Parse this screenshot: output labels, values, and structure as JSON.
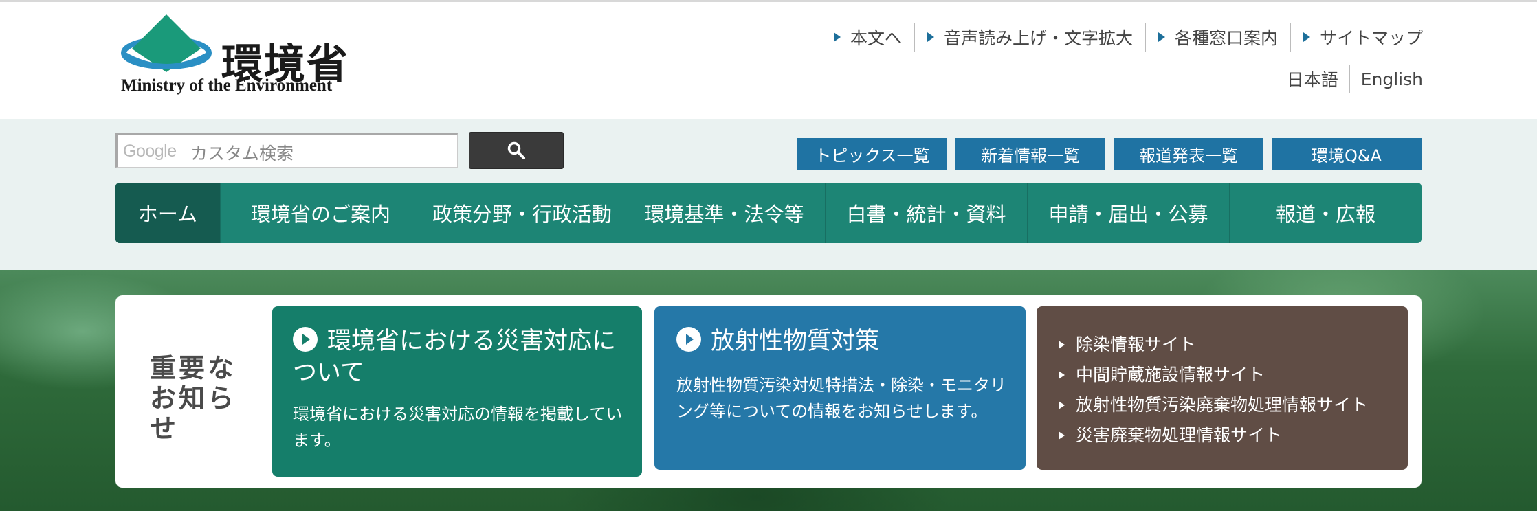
{
  "header": {
    "logo_jp": "環境省",
    "logo_en": "Ministry of the Environment",
    "util_links": [
      "本文へ",
      "音声読み上げ・文字拡大",
      "各種窓口案内",
      "サイトマップ"
    ],
    "languages": [
      "日本語",
      "English"
    ]
  },
  "search": {
    "watermark": "Google",
    "hint": "カスタム検索",
    "value": ""
  },
  "quick_links": [
    "トピックス一覧",
    "新着情報一覧",
    "報道発表一覧",
    "環境Q&A"
  ],
  "global_nav": [
    "ホーム",
    "環境省のご案内",
    "政策分野・行政活動",
    "環境基準・法令等",
    "白書・統計・資料",
    "申請・届出・公募",
    "報道・広報"
  ],
  "notices": {
    "label": "重要なお知らせ",
    "cards": [
      {
        "title": "環境省における災害対応について",
        "desc": "環境省における災害対応の情報を掲載しています。"
      },
      {
        "title": "放射性物質対策",
        "desc": "放射性物質汚染対処特措法・除染・モニタリング等についての情報をお知らせします。"
      }
    ],
    "links": [
      "除染情報サイト",
      "中間貯蔵施設情報サイト",
      "放射性物質汚染廃棄物処理情報サイト",
      "災害廃棄物処理情報サイト"
    ]
  },
  "colors": {
    "nav": "#1d8575",
    "nav_active": "#155b50",
    "quick": "#1f73a3",
    "card_green": "#157e6a",
    "card_blue": "#2578a8",
    "card_brown": "#604d45"
  }
}
